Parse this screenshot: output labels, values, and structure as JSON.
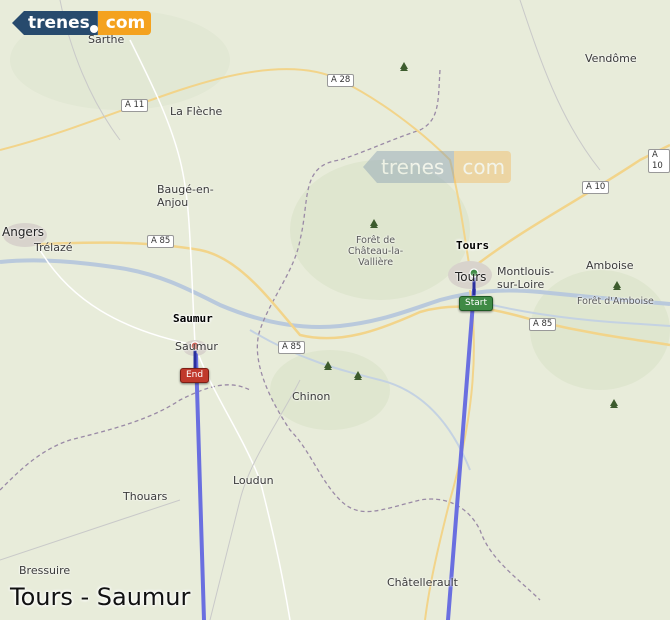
{
  "title": "Tours - Saumur",
  "logo": {
    "left": "trenes",
    "right": "com"
  },
  "watermark": {
    "left": "trenes",
    "right": "com"
  },
  "origin": {
    "name": "Tours",
    "marker": "Start",
    "color": "#3f8a45"
  },
  "destination": {
    "name": "Saumur",
    "marker": "End",
    "color": "#c0392b"
  },
  "route_color": "#6a6fe0",
  "places": {
    "sarthe": "Sarthe",
    "vendome": "Vendôme",
    "la_fleche": "La Flèche",
    "bauge": "Baugé-en-\nAnjou",
    "angers": "Angers",
    "trelaze": "Trélazé",
    "foret_chateau": "Forêt de\nChâteau-la-\nVallière",
    "tours_map": "Tours",
    "montlouis": "Montlouis-\nsur-Loire",
    "amboise": "Amboise",
    "foret_amboise": "Forêt d'Amboise",
    "saumur_map": "Saumur",
    "chinon": "Chinon",
    "loudun": "Loudun",
    "thouars": "Thouars",
    "bressuire": "Bressuire",
    "chatellerault": "Châtellerault"
  },
  "roads": {
    "a28": "A 28",
    "a11": "A 11",
    "a85_west": "A 85",
    "a85_mid": "A 85",
    "a85_east": "A 85",
    "a10_north": "A 10",
    "a10_east": "A 10"
  },
  "icons": [
    "forest-icon",
    "pin-icon"
  ]
}
